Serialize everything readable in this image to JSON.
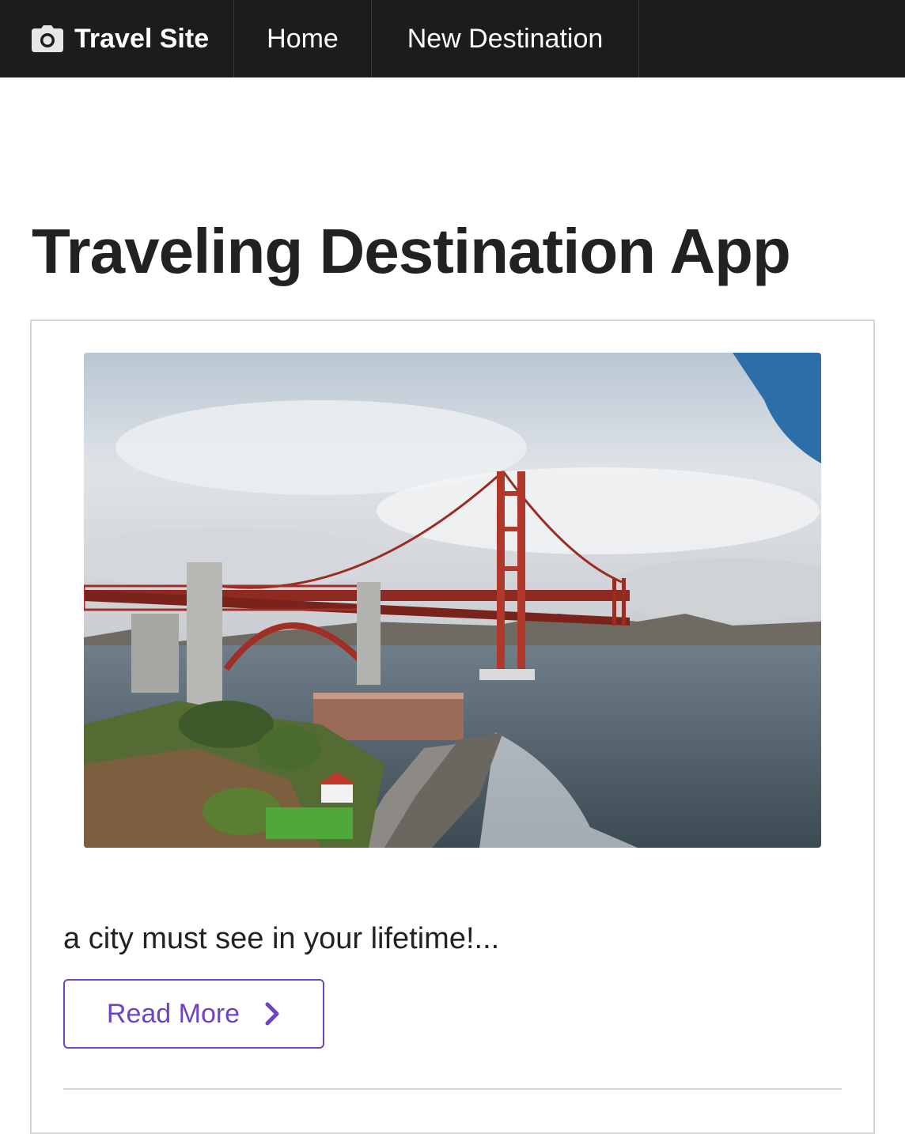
{
  "navbar": {
    "brand_label": "Travel Site",
    "brand_icon": "camera-icon",
    "items": [
      {
        "label": "Home"
      },
      {
        "label": "New Destination"
      }
    ],
    "background": "#1b1c1d"
  },
  "main": {
    "title": "Traveling Destination App",
    "card": {
      "image_subject": "golden-gate-bridge",
      "description": "a city must see in your lifetime!...",
      "button_label": "Read More",
      "button_icon": "chevron-right-icon",
      "accent": "#6c44c4"
    }
  }
}
